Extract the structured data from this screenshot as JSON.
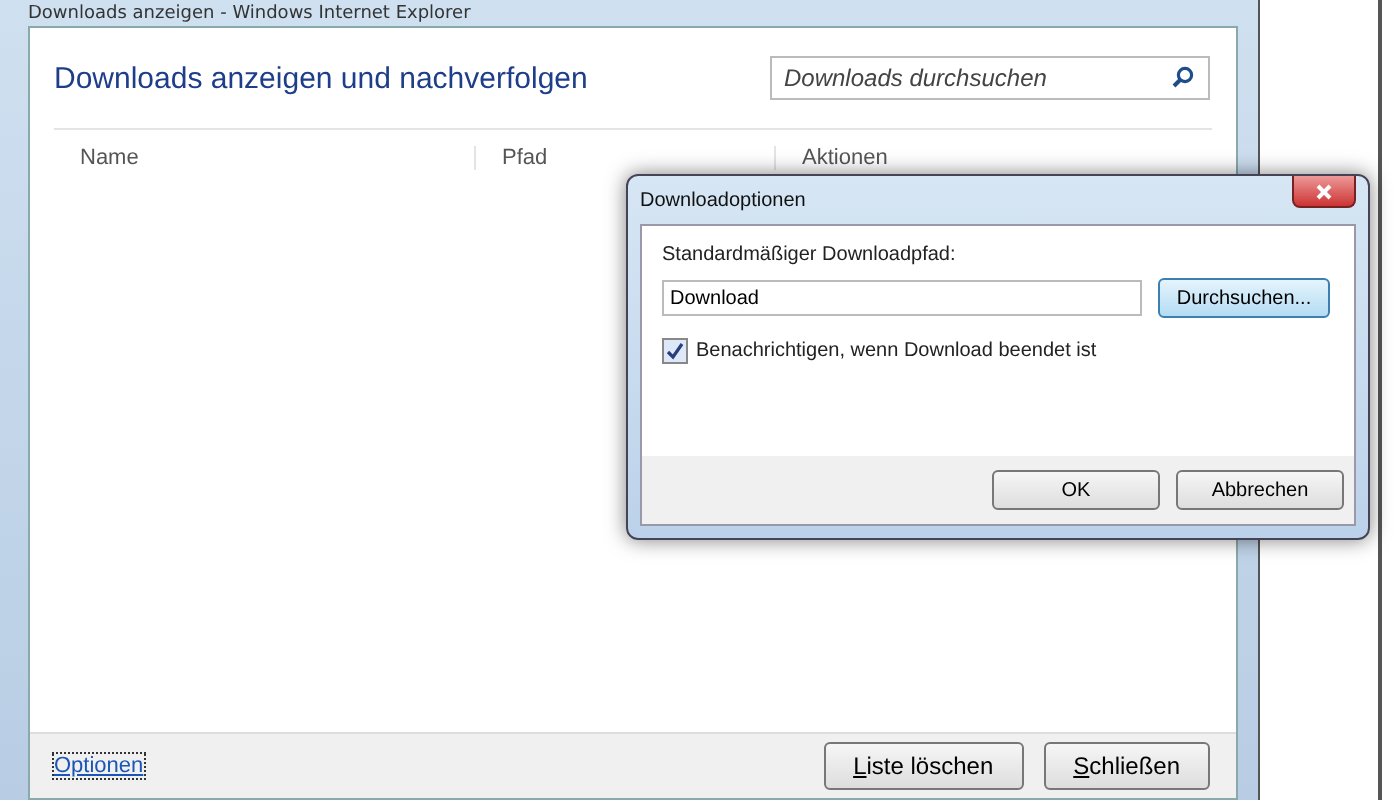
{
  "window": {
    "title": "Downloads anzeigen - Windows Internet Explorer"
  },
  "heading": "Downloads anzeigen und nachverfolgen",
  "search": {
    "placeholder": "Downloads durchsuchen"
  },
  "table": {
    "columns": [
      "Name",
      "Pfad",
      "Aktionen"
    ]
  },
  "footer": {
    "link": "Optionen",
    "buttons": [
      "Liste löschen",
      "Schließen"
    ]
  },
  "dialog": {
    "title": "Downloadoptionen",
    "path_label": "Standardmäßiger Downloadpfad:",
    "path_value": "Download",
    "browse_button": "Durchsuchen...",
    "notify": {
      "label": "Benachrichtigen, wenn Download beendet ist",
      "checked": true
    },
    "buttons": [
      "OK",
      "Abbrechen"
    ]
  }
}
